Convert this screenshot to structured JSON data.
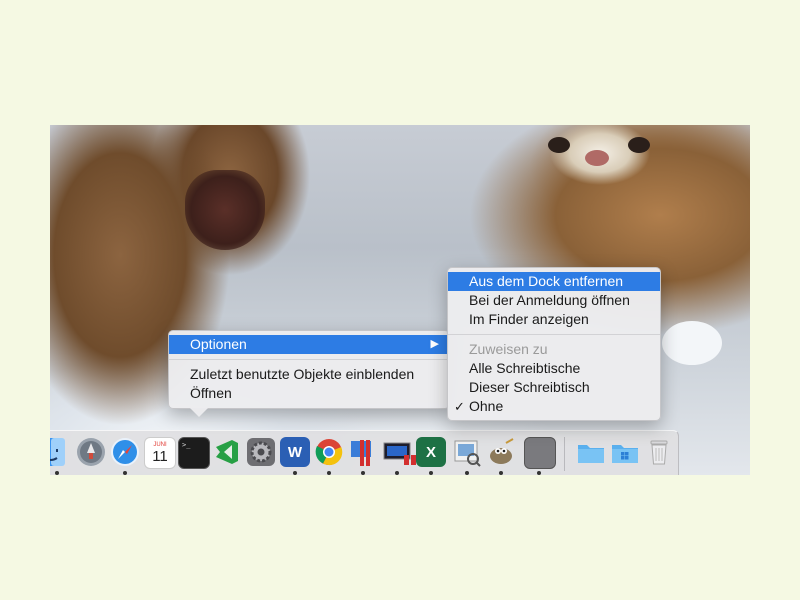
{
  "context_menu": {
    "options_label": "Optionen",
    "items": [
      "Zuletzt benutzte Objekte einblenden",
      "Öffnen"
    ]
  },
  "submenu": {
    "items_top": [
      "Aus dem Dock entfernen",
      "Bei der Anmeldung öffnen",
      "Im Finder anzeigen"
    ],
    "assign_header": "Zuweisen zu",
    "assign_items": [
      "Alle Schreibtische",
      "Dieser Schreibtisch",
      "Ohne"
    ],
    "checkmark": "✓"
  },
  "dock": {
    "calendar_month": "JUNI",
    "calendar_day": "11",
    "terminal_prompt": ">_",
    "word_letter": "W",
    "excel_letter": "X",
    "icons": [
      "finder-icon",
      "launchpad-icon",
      "safari-icon",
      "calendar-icon",
      "terminal-icon",
      "visual-studio-code-icon",
      "system-preferences-icon",
      "word-icon",
      "chrome-icon",
      "parallels-icon",
      "remote-desktop-icon",
      "windows-vm-icon",
      "excel-icon",
      "preview-icon",
      "gimp-icon",
      "blank-window-icon",
      "folder-icon",
      "windows-folder-icon",
      "trash-icon"
    ]
  },
  "colors": {
    "highlight": "#2d7ce4",
    "page_background": "#f5f9e3"
  }
}
